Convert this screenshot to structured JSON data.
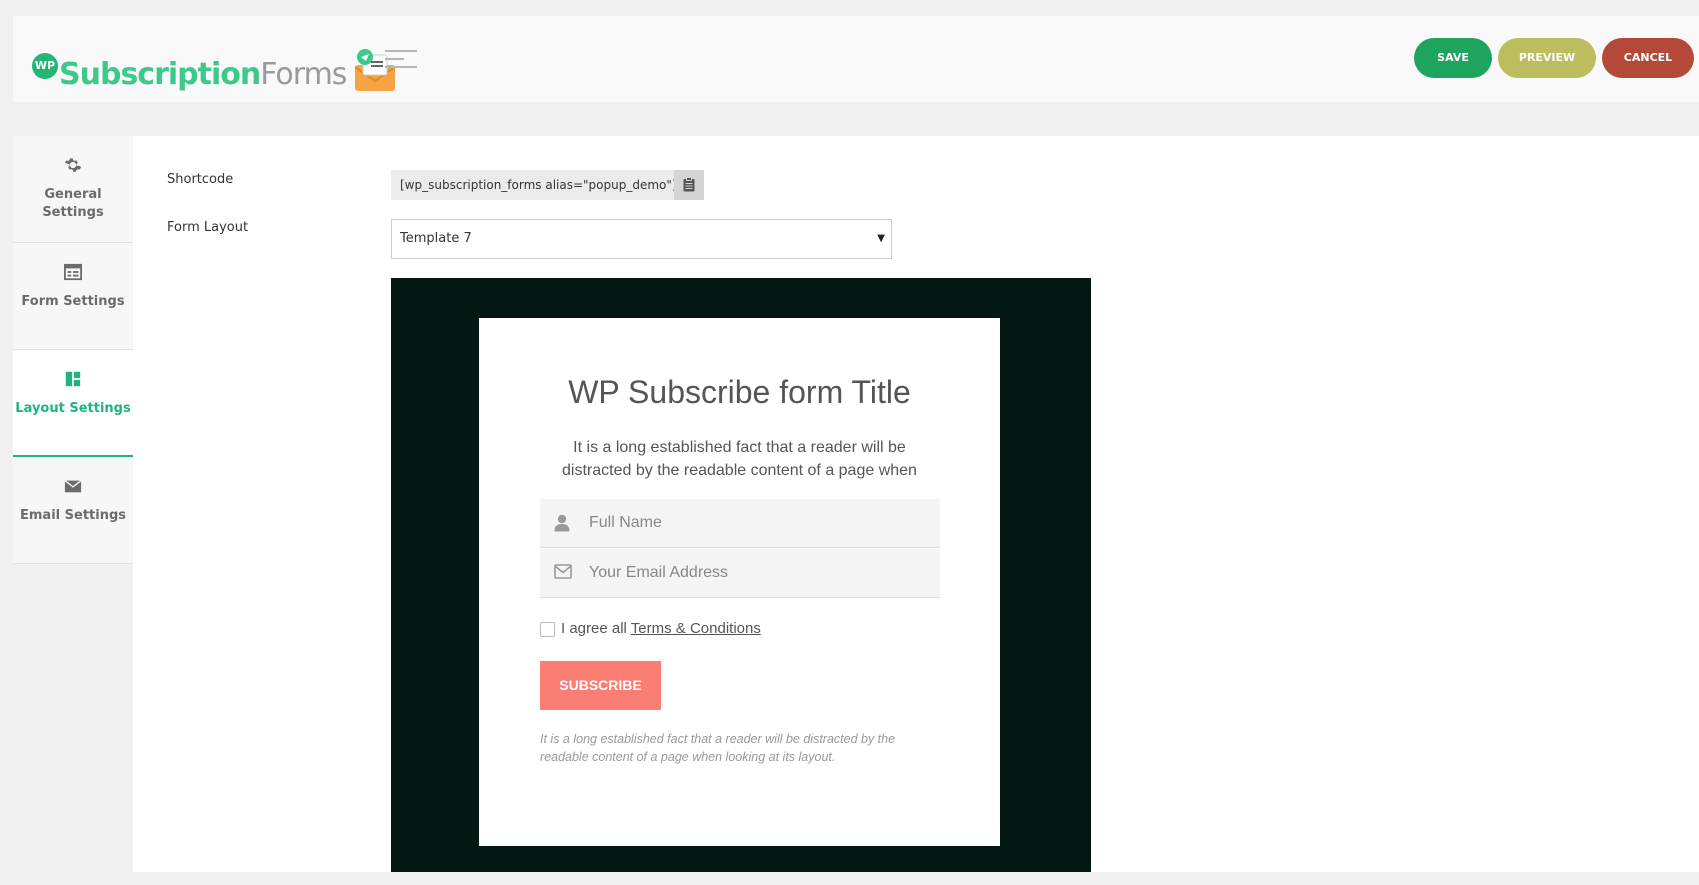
{
  "header": {
    "logo_wp": "WP",
    "logo_subscription": "Subscription",
    "logo_forms": "Forms",
    "save_label": "SAVE",
    "preview_label": "PREVIEW",
    "cancel_label": "CANCEL",
    "colors": {
      "save": "#1fa45e",
      "preview": "#bcbd5f",
      "cancel": "#b54939"
    }
  },
  "sidebar": {
    "items": [
      {
        "label": "General Settings",
        "icon": "gear-icon",
        "active": false
      },
      {
        "label": "Form Settings",
        "icon": "form-icon",
        "active": false
      },
      {
        "label": "Layout Settings",
        "icon": "layout-icon",
        "active": true
      },
      {
        "label": "Email Settings",
        "icon": "envelope-icon",
        "active": false
      }
    ],
    "accent": "#1eb47f"
  },
  "main": {
    "shortcode_label": "Shortcode",
    "shortcode_value": "[wp_subscription_forms alias=\"popup_demo\"]",
    "form_layout_label": "Form Layout",
    "form_layout_value": "Template 7"
  },
  "preview": {
    "title": "WP Subscribe form Title",
    "description": "It is a long established fact that a reader will be distracted by the readable content of a page when",
    "name_placeholder": "Full Name",
    "email_placeholder": "Your Email Address",
    "agree_text": "I agree all",
    "terms_text": "Terms & Conditions",
    "subscribe_label": "SUBSCRIBE",
    "footer_note": "It is a long established fact that a reader will be distracted by the readable content of a page when looking at its layout.",
    "colors": {
      "background": "#041813",
      "button": "#fa7e74"
    }
  }
}
